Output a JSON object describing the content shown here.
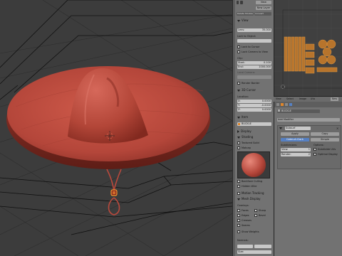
{
  "npanel": {
    "new_label": "New",
    "new_layer_label": "New Layer",
    "delete_strokes": "Delete Strokes",
    "convert_label": "Convert",
    "view_header": "View",
    "lens_field": "Lens:",
    "lens_value": "35.000",
    "lock_to_object": "Lock to Object:",
    "lock_to_cursor": "Lock to Cursor",
    "lock_camera_to_view": "Lock Camera to View",
    "clip_label": "Clip:",
    "start_label": "Start:",
    "start_value": "0.100",
    "end_label": "End:",
    "end_value": "1000.000",
    "local_camera": "Local Camera:",
    "render_border": "Render Border",
    "cursor_header": "3D Cursor",
    "location_label": "Location:",
    "x_label": "X:",
    "x_value": "0.0000",
    "y_label": "Y:",
    "y_value": "-0.0000",
    "z_label": "Z:",
    "z_value": "0.0000",
    "item_header": "Item",
    "item_name": "BUCKLE",
    "display_header": "Display",
    "shading_header": "Shading",
    "textured_solid": "Textured Solid",
    "matcap": "Matcap",
    "backface_culling": "Backface Culling",
    "hidden_wire": "Hidden Wire",
    "motion_tracking": "Motion Tracking",
    "mesh_display": "Mesh Display",
    "overlays_label": "Overlays:",
    "faces": "Faces",
    "sharp": "Sharp",
    "edges": "Edges",
    "bevel": "Bevel",
    "creases": "Creases",
    "seams": "Seams",
    "show_weights": "Show Weights",
    "normals_label": "Normals:",
    "size_label": "Size:"
  },
  "uvbar": {
    "view": "View",
    "select": "Select",
    "image": "Image",
    "uvs": "UVs",
    "new": "New"
  },
  "properties": {
    "object_name": "BUCKLE",
    "add_modifier": "Add Modifier",
    "modifier_name": "Subsurf",
    "apply": "Apply",
    "copy": "Copy",
    "catmull_clark": "Catmull-Clark",
    "simple": "Simple",
    "subdivisions": "Subdivisions:",
    "options": "Options:",
    "view_label": "View:",
    "view_value": "1",
    "render_label": "Render:",
    "render_value": "2",
    "subdivide_uvs": "Subdivide UVs",
    "optimal_display": "Optimal Display"
  },
  "colors": {
    "viewport_bg": "#3c3c3c",
    "hat": "#b9493c",
    "panel": "#727272",
    "accent_blue": "#5680c2",
    "orange_selection": "#e0862a"
  }
}
